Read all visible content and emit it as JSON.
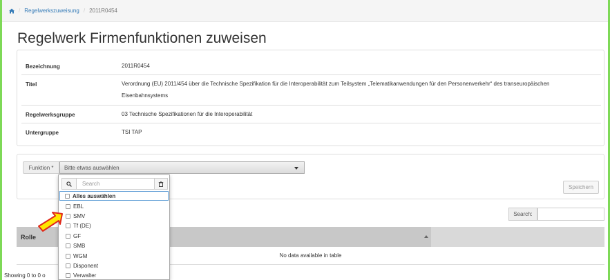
{
  "breadcrumb": {
    "link": "Regelwerkszuweisung",
    "separator": "/",
    "current": "2011R0454"
  },
  "page_title": "Regelwerk Firmenfunktionen zuweisen",
  "details": {
    "rows": [
      {
        "label": "Bezeichnung",
        "value": "2011R0454"
      },
      {
        "label": "Titel",
        "value": "Verordnung (EU) 2011/454 über die Technische Spezifikation für die Interoperabilität zum Teilsystem „Telematikanwendungen für den Personenverkehr“ des transeuropäischen Eisenbahnsystems"
      },
      {
        "label": "Regelwerksgruppe",
        "value": "03 Technische Spezifikationen für die Interoperabilität"
      },
      {
        "label": "Untergruppe",
        "value": "TSI TAP"
      }
    ]
  },
  "filter": {
    "function_label": "Funktion *",
    "function_placeholder": "Bitte etwas auswählen",
    "save_label": "Speichern"
  },
  "dropdown": {
    "search_placeholder": "Search",
    "select_all": "Alles auswählen",
    "options": [
      "EBL",
      "SMV",
      "Tf (DE)",
      "GF",
      "SMB",
      "WGM",
      "Disponent",
      "Verwalter"
    ]
  },
  "table": {
    "search_label": "Search:",
    "column_role": "Rolle",
    "empty_message": "No data available in table",
    "info": "Showing 0 to 0 o"
  },
  "colors": {
    "accent_frame": "#7ed957",
    "arrow_fill": "#ffe600",
    "arrow_stroke": "#e0281b",
    "link": "#337ab7"
  }
}
